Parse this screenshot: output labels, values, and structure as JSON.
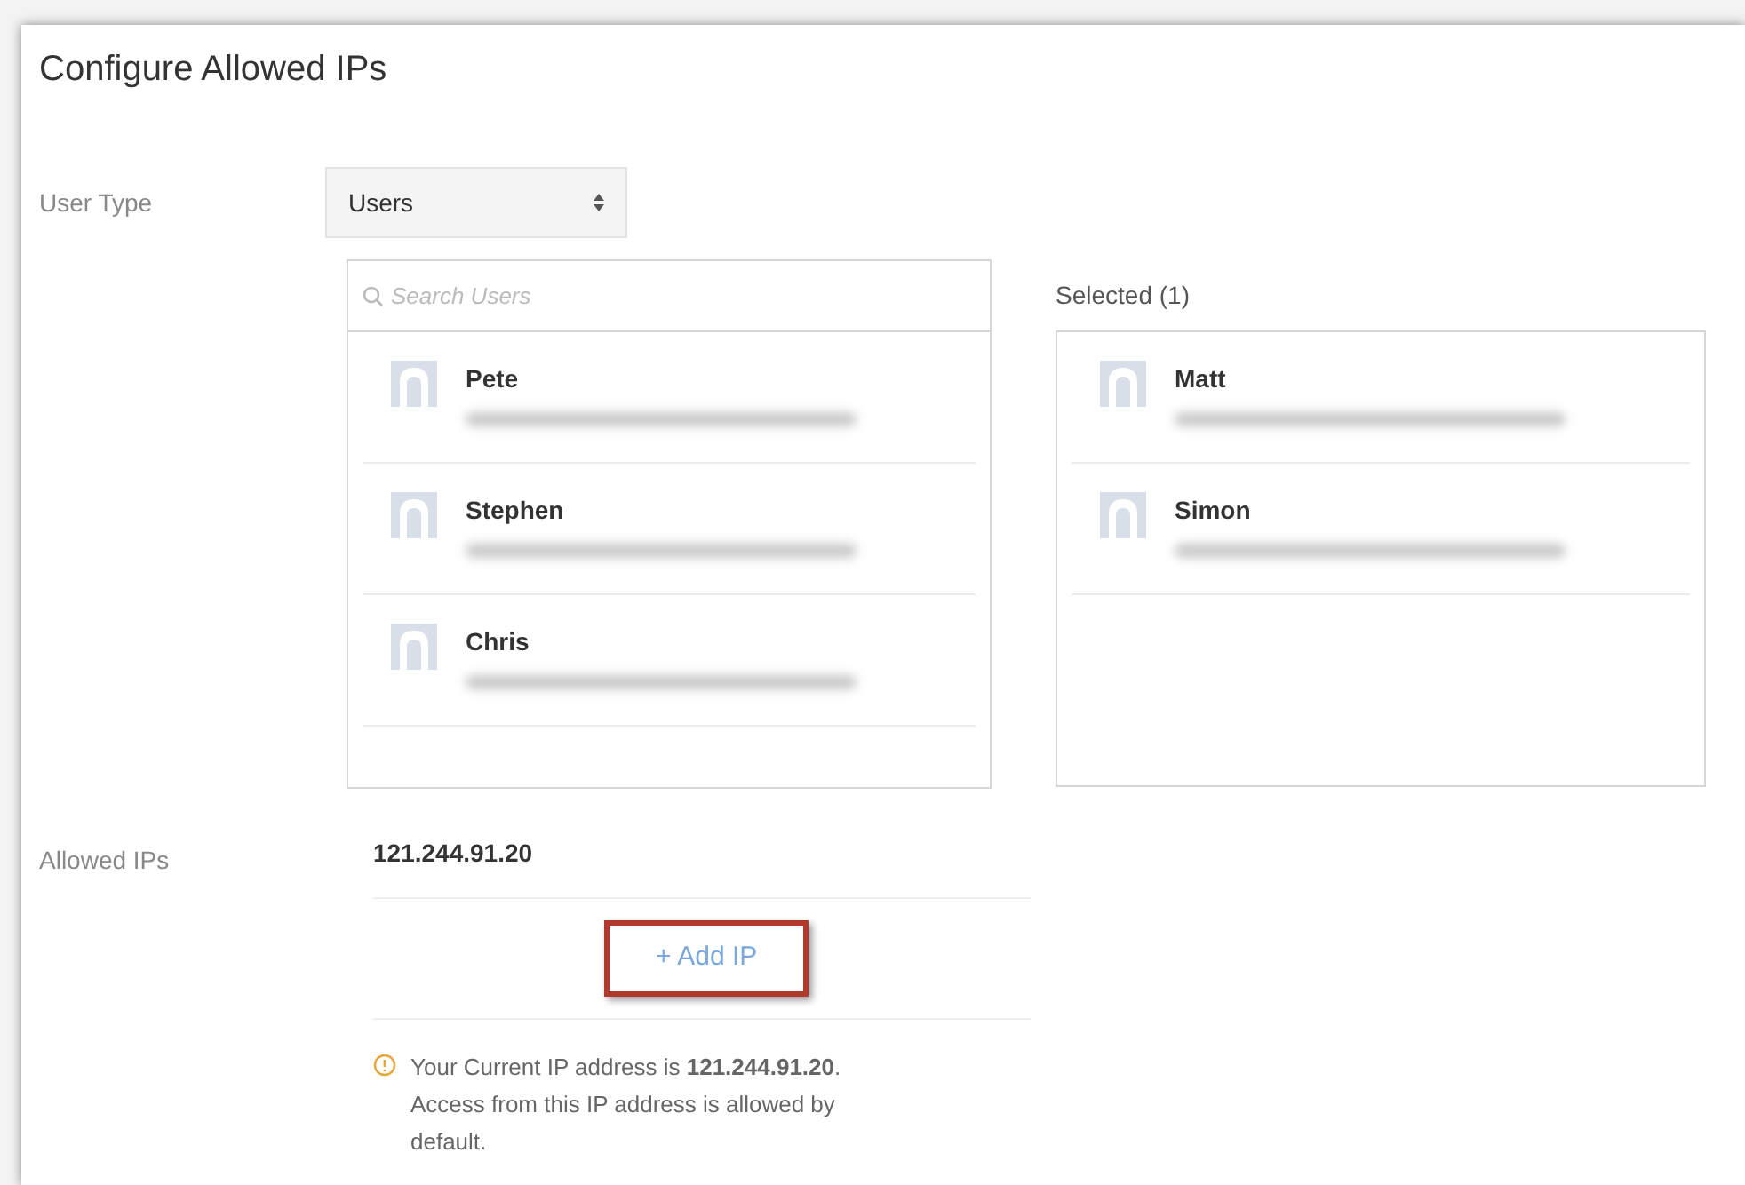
{
  "window": {
    "title": "Configure Allowed IPs"
  },
  "user_type": {
    "label": "User Type",
    "value": "Users"
  },
  "search": {
    "placeholder": "Search Users"
  },
  "available_users": [
    {
      "name": "Pete"
    },
    {
      "name": "Stephen"
    },
    {
      "name": "Chris"
    }
  ],
  "selected_heading": "Selected (1)",
  "selected_users": [
    {
      "name": "Matt"
    },
    {
      "name": "Simon"
    }
  ],
  "allowed_ips": {
    "label": "Allowed IPs",
    "values": [
      "121.244.91.20"
    ]
  },
  "add_button": "+ Add IP",
  "notice": "Your Current IP address is **121.244.91.20**. Access from this IP address is allowed by default."
}
